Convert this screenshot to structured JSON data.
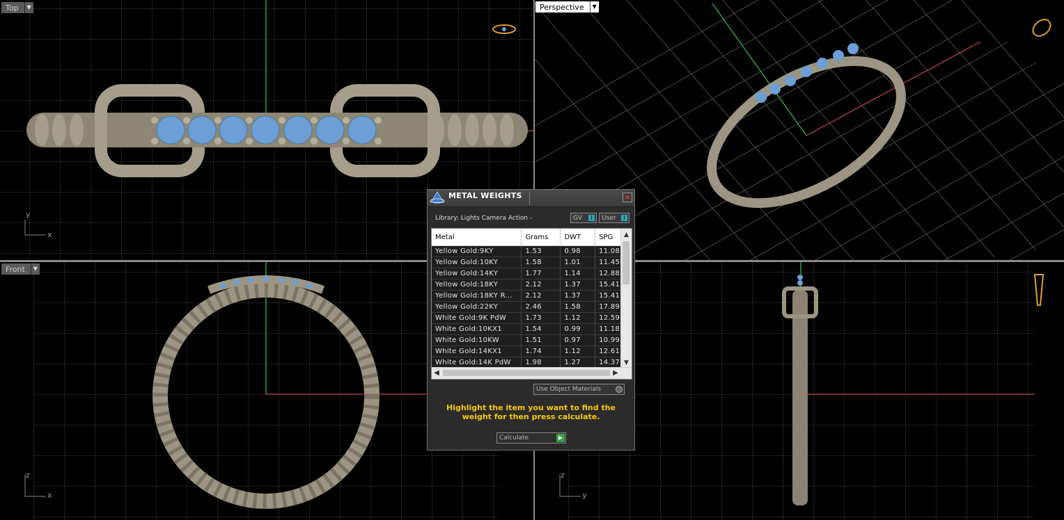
{
  "viewports": {
    "top": {
      "label": "Top",
      "axis_a": "y",
      "axis_b": "x"
    },
    "perspective": {
      "label": "Perspective"
    },
    "front": {
      "label": "Front",
      "axis_a": "z",
      "axis_b": "x"
    },
    "right": {
      "label": "",
      "axis_a": "z",
      "axis_b": "y"
    }
  },
  "dialog": {
    "title": "METAL WEIGHTS",
    "library": "Library: Lights Camera Action -",
    "toggle_gv": "GV",
    "toggle_user": "User",
    "columns": [
      "Metal",
      "Grams",
      "DWT",
      "SPG"
    ],
    "rows": [
      [
        "Yellow Gold:9KY",
        "1.53",
        "0.98",
        "11.08"
      ],
      [
        "Yellow Gold:10KY",
        "1.58",
        "1.01",
        "11.45"
      ],
      [
        "Yellow Gold:14KY",
        "1.77",
        "1.14",
        "12.88"
      ],
      [
        "Yellow Gold:18KY",
        "2.12",
        "1.37",
        "15.41"
      ],
      [
        "Yellow Gold:18KY R...",
        "2.12",
        "1.37",
        "15.41"
      ],
      [
        "Yellow Gold:22KY",
        "2.46",
        "1.58",
        "17.89"
      ],
      [
        "White Gold:9K PdW",
        "1.73",
        "1.12",
        "12.59"
      ],
      [
        "White Gold:10KX1",
        "1.54",
        "0.99",
        "11.18"
      ],
      [
        "White Gold:10KW",
        "1.51",
        "0.97",
        "10.99"
      ],
      [
        "White Gold:14KX1",
        "1.74",
        "1.12",
        "12.61"
      ],
      [
        "White Gold:14K PdW",
        "1.98",
        "1.27",
        "14.37"
      ]
    ],
    "use_object_materials": "Use Object Materials",
    "hint": "Highlight the item you want to find the weight for then press calculate.",
    "calculate": "Calculate"
  },
  "colors": {
    "metal": "#9c9583",
    "gem": "#6b9fd6",
    "grid": "#3c3c3c",
    "x_axis": "#a03c3c",
    "y_axis": "#2ea03a",
    "hint": "#f5c800"
  }
}
